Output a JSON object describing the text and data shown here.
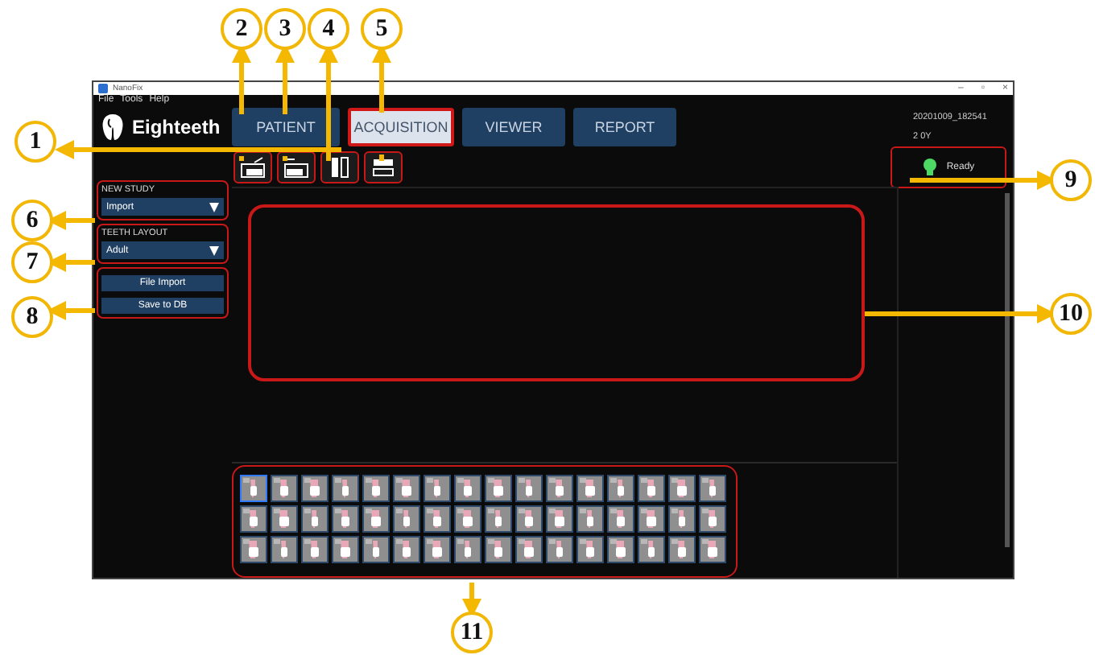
{
  "window": {
    "title": "NanoFix",
    "controls": [
      "–",
      "▫",
      "×"
    ]
  },
  "menu": [
    "File",
    "Tools",
    "Help"
  ],
  "logo": {
    "text": "Eighteeth"
  },
  "tabs": [
    {
      "label": "PATIENT",
      "selected": false
    },
    {
      "label": "ACQUISITION",
      "selected": true
    },
    {
      "label": "VIEWER",
      "selected": false
    },
    {
      "label": "REPORT",
      "selected": false
    }
  ],
  "patient_info": [
    "20201009_182541",
    "2 0Y"
  ],
  "toolbar": [
    {
      "kind": "import"
    },
    {
      "kind": "export"
    },
    {
      "kind": "columns"
    },
    {
      "kind": "rows"
    }
  ],
  "status": {
    "text": "Ready",
    "on": true
  },
  "sidebar": {
    "sections": [
      {
        "label": "NEW STUDY",
        "value": "Import"
      },
      {
        "label": "TEETH LAYOUT",
        "value": "Adult"
      }
    ],
    "buttons": [
      "File Import",
      "Save to DB"
    ]
  },
  "tooth_rows": [
    [
      {
        "selected": true
      },
      {
        "selected": false
      },
      {
        "selected": false
      },
      {
        "selected": false
      },
      {
        "selected": false
      },
      {
        "selected": false
      },
      {
        "selected": false
      },
      {
        "selected": false
      },
      {
        "selected": false
      },
      {
        "selected": false
      },
      {
        "selected": false
      },
      {
        "selected": false
      },
      {
        "selected": false
      },
      {
        "selected": false
      },
      {
        "selected": false
      },
      {
        "selected": false
      }
    ],
    [
      {
        "selected": false
      },
      {
        "selected": false
      },
      {
        "selected": false
      },
      {
        "selected": false
      },
      {
        "selected": false
      },
      {
        "selected": false
      },
      {
        "selected": false
      },
      {
        "selected": false
      },
      {
        "selected": false
      },
      {
        "selected": false
      },
      {
        "selected": false
      },
      {
        "selected": false
      },
      {
        "selected": false
      },
      {
        "selected": false
      },
      {
        "selected": false
      },
      {
        "selected": false
      }
    ],
    [
      {
        "selected": false
      },
      {
        "selected": false
      },
      {
        "selected": false
      },
      {
        "selected": false
      },
      {
        "selected": false
      },
      {
        "selected": false
      },
      {
        "selected": false
      },
      {
        "selected": false
      },
      {
        "selected": false
      },
      {
        "selected": false
      },
      {
        "selected": false
      },
      {
        "selected": false
      },
      {
        "selected": false
      },
      {
        "selected": false
      },
      {
        "selected": false
      },
      {
        "selected": false
      }
    ]
  ],
  "callouts": [
    "1",
    "2",
    "3",
    "4",
    "5",
    "6",
    "7",
    "8",
    "9",
    "10",
    "11"
  ]
}
